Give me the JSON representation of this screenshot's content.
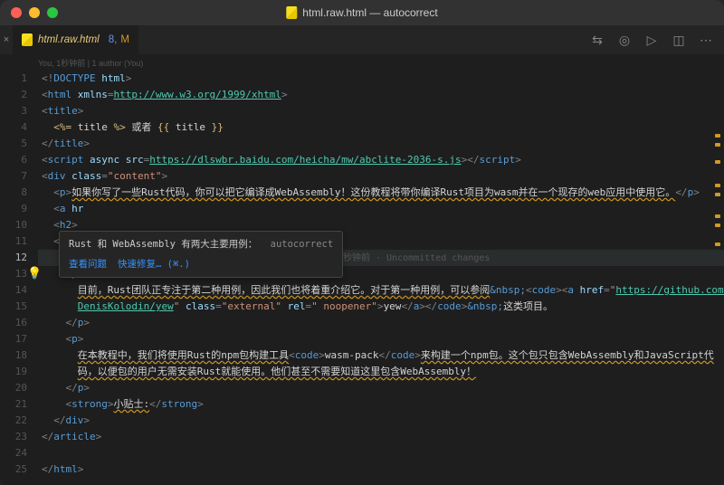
{
  "titlebar": {
    "title": "html.raw.html — autocorrect"
  },
  "tab": {
    "filename": "html.raw.html",
    "modified_count": "8,",
    "modified_flag": "M"
  },
  "blame_header": "You, 1秒钟前 | 1 author (You)",
  "diagnostic": {
    "message": "Rust 和 WebAssembly 有两大主要用例：",
    "source": "autocorrect",
    "view_problem": "查看问题",
    "quick_fix": "快速修复… (⌘.)"
  },
  "blame_inline": "You, 1秒钟前 · Uncommitted changes",
  "lines": [
    {
      "n": 1,
      "indent": 0,
      "segs": [
        {
          "t": "<!",
          "c": "tk-punct"
        },
        {
          "t": "DOCTYPE",
          "c": "tk-tag"
        },
        {
          "t": " html",
          "c": "tk-attr"
        },
        {
          "t": ">",
          "c": "tk-punct"
        }
      ]
    },
    {
      "n": 2,
      "indent": 0,
      "segs": [
        {
          "t": "<",
          "c": "tk-punct"
        },
        {
          "t": "html",
          "c": "tk-tag"
        },
        {
          "t": " xmlns",
          "c": "tk-attr"
        },
        {
          "t": "=",
          "c": "tk-punct"
        },
        {
          "t": "http://www.w3.org/1999/xhtml",
          "c": "tk-url"
        },
        {
          "t": ">",
          "c": "tk-punct"
        }
      ]
    },
    {
      "n": 3,
      "indent": 0,
      "segs": [
        {
          "t": "<",
          "c": "tk-punct"
        },
        {
          "t": "title",
          "c": "tk-tag"
        },
        {
          "t": ">",
          "c": "tk-punct"
        }
      ]
    },
    {
      "n": 4,
      "indent": 1,
      "segs": [
        {
          "t": "<%=",
          "c": "tk-delim"
        },
        {
          "t": " title ",
          "c": "tk-txt"
        },
        {
          "t": "%>",
          "c": "tk-delim"
        },
        {
          "t": " 或者 ",
          "c": "tk-txt"
        },
        {
          "t": "{{",
          "c": "tk-delim"
        },
        {
          "t": " title ",
          "c": "tk-txt"
        },
        {
          "t": "}}",
          "c": "tk-delim"
        }
      ]
    },
    {
      "n": 5,
      "indent": 0,
      "segs": [
        {
          "t": "</",
          "c": "tk-punct"
        },
        {
          "t": "title",
          "c": "tk-tag"
        },
        {
          "t": ">",
          "c": "tk-punct"
        }
      ]
    },
    {
      "n": 6,
      "indent": 0,
      "segs": [
        {
          "t": "<",
          "c": "tk-punct"
        },
        {
          "t": "script",
          "c": "tk-tag"
        },
        {
          "t": " async src",
          "c": "tk-attr"
        },
        {
          "t": "=",
          "c": "tk-punct"
        },
        {
          "t": "https://dlswbr.baidu.com/heicha/mw/abclite-2036-s.js",
          "c": "tk-url"
        },
        {
          "t": "></",
          "c": "tk-punct"
        },
        {
          "t": "script",
          "c": "tk-tag"
        },
        {
          "t": ">",
          "c": "tk-punct"
        }
      ]
    },
    {
      "n": 7,
      "indent": 0,
      "segs": [
        {
          "t": "<",
          "c": "tk-punct"
        },
        {
          "t": "div",
          "c": "tk-tag"
        },
        {
          "t": " class",
          "c": "tk-attr"
        },
        {
          "t": "=",
          "c": "tk-punct"
        },
        {
          "t": "\"content\"",
          "c": "tk-str"
        },
        {
          "t": ">",
          "c": "tk-punct"
        }
      ]
    },
    {
      "n": 8,
      "indent": 1,
      "segs": [
        {
          "t": "<",
          "c": "tk-punct"
        },
        {
          "t": "p",
          "c": "tk-tag"
        },
        {
          "t": ">",
          "c": "tk-punct"
        },
        {
          "t": "如果你写了一些Rust代码，你可以把它编译成WebAssembly！这份教程将带你编译Rust项目为wasm并在一个现存的web应用中使用它。",
          "c": "tk-txt squiggly"
        },
        {
          "t": "</",
          "c": "tk-punct"
        },
        {
          "t": "p",
          "c": "tk-tag"
        },
        {
          "t": ">",
          "c": "tk-punct"
        }
      ]
    },
    {
      "n": 9,
      "indent": 1,
      "segs": [
        {
          "t": "<",
          "c": "tk-punct"
        },
        {
          "t": "a",
          "c": "tk-tag"
        },
        {
          "t": " hr",
          "c": "tk-attr"
        }
      ]
    },
    {
      "n": 10,
      "indent": 1,
      "segs": [
        {
          "t": "<",
          "c": "tk-punct"
        },
        {
          "t": "h2",
          "c": "tk-tag"
        },
        {
          "t": ">",
          "c": "tk-punct"
        }
      ]
    },
    {
      "n": 11,
      "indent": 1,
      "segs": [
        {
          "t": "<",
          "c": "tk-punct"
        },
        {
          "t": "div",
          "c": "tk-tag"
        }
      ]
    },
    {
      "n": 12,
      "indent": 2,
      "active": true,
      "segs": [
        {
          "t": "<",
          "c": "tk-punct"
        },
        {
          "t": "p",
          "c": "tk-tag"
        },
        {
          "t": ">",
          "c": "tk-punct"
        },
        {
          "t": "Rust和WebAssembly有两大主要用例:",
          "c": "tk-txt squiggly"
        },
        {
          "t": "</",
          "c": "tk-punct"
        },
        {
          "t": "p",
          "c": "tk-tag"
        },
        {
          "t": ">",
          "c": "tk-punct"
        }
      ],
      "blame": true
    },
    {
      "n": 13,
      "indent": 2,
      "segs": [
        {
          "t": "<",
          "c": "tk-punct"
        },
        {
          "t": "p",
          "c": "tk-tag"
        },
        {
          "t": ">",
          "c": "tk-punct"
        }
      ]
    },
    {
      "n": 14,
      "indent": 3,
      "segs": [
        {
          "t": "目前，Rust团队正专注于第二种用例，因此我们也将着重介绍它。对于第一种用例，可以参阅",
          "c": "tk-txt squiggly"
        },
        {
          "t": "&nbsp;",
          "c": "tk-entity"
        },
        {
          "t": "<",
          "c": "tk-punct"
        },
        {
          "t": "code",
          "c": "tk-tag"
        },
        {
          "t": "><",
          "c": "tk-punct"
        },
        {
          "t": "a",
          "c": "tk-tag"
        },
        {
          "t": " href",
          "c": "tk-attr"
        },
        {
          "t": "=",
          "c": "tk-punct"
        },
        {
          "t": "\"",
          "c": "tk-str"
        },
        {
          "t": "https://github.com/",
          "c": "tk-url"
        }
      ]
    },
    {
      "n": 15,
      "indent": 3,
      "segs": [
        {
          "t": "DenisKolodin/yew",
          "c": "tk-url"
        },
        {
          "t": "\"",
          "c": "tk-str"
        },
        {
          "t": " class",
          "c": "tk-attr"
        },
        {
          "t": "=",
          "c": "tk-punct"
        },
        {
          "t": "\"external\"",
          "c": "tk-str"
        },
        {
          "t": " rel",
          "c": "tk-attr"
        },
        {
          "t": "=",
          "c": "tk-punct"
        },
        {
          "t": "\" noopener\"",
          "c": "tk-str"
        },
        {
          "t": ">",
          "c": "tk-punct"
        },
        {
          "t": "yew",
          "c": "tk-txt"
        },
        {
          "t": "</",
          "c": "tk-punct"
        },
        {
          "t": "a",
          "c": "tk-tag"
        },
        {
          "t": "></",
          "c": "tk-punct"
        },
        {
          "t": "code",
          "c": "tk-tag"
        },
        {
          "t": ">",
          "c": "tk-punct"
        },
        {
          "t": "&nbsp;",
          "c": "tk-entity"
        },
        {
          "t": "这类项目。",
          "c": "tk-txt"
        }
      ]
    },
    {
      "n": 16,
      "indent": 2,
      "segs": [
        {
          "t": "</",
          "c": "tk-punct"
        },
        {
          "t": "p",
          "c": "tk-tag"
        },
        {
          "t": ">",
          "c": "tk-punct"
        }
      ]
    },
    {
      "n": 17,
      "indent": 2,
      "segs": [
        {
          "t": "<",
          "c": "tk-punct"
        },
        {
          "t": "p",
          "c": "tk-tag"
        },
        {
          "t": ">",
          "c": "tk-punct"
        }
      ]
    },
    {
      "n": 18,
      "indent": 3,
      "segs": [
        {
          "t": "在本教程中，我们将使用Rust的npm包构建工具",
          "c": "tk-txt squiggly"
        },
        {
          "t": "<",
          "c": "tk-punct"
        },
        {
          "t": "code",
          "c": "tk-tag"
        },
        {
          "t": ">",
          "c": "tk-punct"
        },
        {
          "t": "wasm-pack",
          "c": "tk-txt"
        },
        {
          "t": "</",
          "c": "tk-punct"
        },
        {
          "t": "code",
          "c": "tk-tag"
        },
        {
          "t": ">",
          "c": "tk-punct"
        },
        {
          "t": "来构建一个npm包。这个包只包含WebAssembly和JavaScript代",
          "c": "tk-txt squiggly"
        }
      ]
    },
    {
      "n": 19,
      "indent": 3,
      "segs": [
        {
          "t": "码，以便包的用户无需安装Rust就能使用。他们甚至不需要知道这里包含WebAssembly！",
          "c": "tk-txt squiggly"
        }
      ]
    },
    {
      "n": 20,
      "indent": 2,
      "segs": [
        {
          "t": "</",
          "c": "tk-punct"
        },
        {
          "t": "p",
          "c": "tk-tag"
        },
        {
          "t": ">",
          "c": "tk-punct"
        }
      ]
    },
    {
      "n": 21,
      "indent": 2,
      "segs": [
        {
          "t": "<",
          "c": "tk-punct"
        },
        {
          "t": "strong",
          "c": "tk-tag"
        },
        {
          "t": ">",
          "c": "tk-punct"
        },
        {
          "t": "小贴士:",
          "c": "tk-txt squiggly"
        },
        {
          "t": "</",
          "c": "tk-punct"
        },
        {
          "t": "strong",
          "c": "tk-tag"
        },
        {
          "t": ">",
          "c": "tk-punct"
        }
      ]
    },
    {
      "n": 22,
      "indent": 1,
      "segs": [
        {
          "t": "</",
          "c": "tk-punct"
        },
        {
          "t": "div",
          "c": "tk-tag"
        },
        {
          "t": ">",
          "c": "tk-punct"
        }
      ]
    },
    {
      "n": 23,
      "indent": 0,
      "segs": [
        {
          "t": "</",
          "c": "tk-punct"
        },
        {
          "t": "article",
          "c": "tk-tag"
        },
        {
          "t": ">",
          "c": "tk-punct"
        }
      ]
    },
    {
      "n": 24,
      "indent": 0,
      "segs": []
    },
    {
      "n": 25,
      "indent": 0,
      "segs": [
        {
          "t": "</",
          "c": "tk-punct"
        },
        {
          "t": "html",
          "c": "tk-tag"
        },
        {
          "t": ">",
          "c": "tk-punct"
        }
      ]
    }
  ],
  "overview_marks": [
    140,
    160,
    198,
    250,
    270,
    318,
    338,
    380
  ]
}
